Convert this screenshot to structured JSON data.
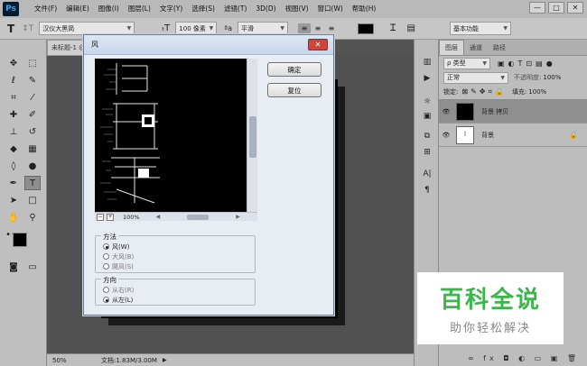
{
  "app": {
    "logo": "Ps"
  },
  "menu": [
    "文件(F)",
    "编辑(E)",
    "图像(I)",
    "图层(L)",
    "文字(Y)",
    "选择(S)",
    "滤镜(T)",
    "3D(D)",
    "视图(V)",
    "窗口(W)",
    "帮助(H)"
  ],
  "window_controls": {
    "minimize": "—",
    "restore": "□",
    "close": "✕"
  },
  "options": {
    "tool_glyph": "T",
    "font_family": "汉仪大黑简",
    "font_size": "100 像素",
    "antialias": "平滑",
    "workspace": "基本功能",
    "text_color": "#000000"
  },
  "document": {
    "tab": "未标题-1 @",
    "zoom": "50%",
    "doc_info": "文档:1.83M/3.00M"
  },
  "dialog": {
    "title": "风",
    "ok": "确定",
    "reset": "复位",
    "zoom": "100%",
    "zoom_out": "−",
    "zoom_in": "+",
    "method": {
      "label": "方法",
      "options": [
        "风(W)",
        "大风(B)",
        "飓风(S)"
      ],
      "selected": 0
    },
    "direction": {
      "label": "方向",
      "options": [
        "从右(R)",
        "从左(L)"
      ],
      "selected": 1
    }
  },
  "panel": {
    "tabs": [
      "图层",
      "通道",
      "路径"
    ],
    "filter_kind": "ρ 类型",
    "blend_mode": "正常",
    "opacity_label": "不透明度:",
    "opacity": "100%",
    "lock_label": "锁定:",
    "fill_label": "填充:",
    "fill": "100%",
    "layers": [
      {
        "name": "背景 拷贝",
        "selected": true
      },
      {
        "name": "背景",
        "selected": false
      }
    ],
    "bottom_icons": "∞ fx ◘ ◐ ▭ ▣ 🗑"
  },
  "watermark": {
    "title": "百科全说",
    "subtitle": "助你轻松解决",
    "color": "#3cb54a"
  }
}
